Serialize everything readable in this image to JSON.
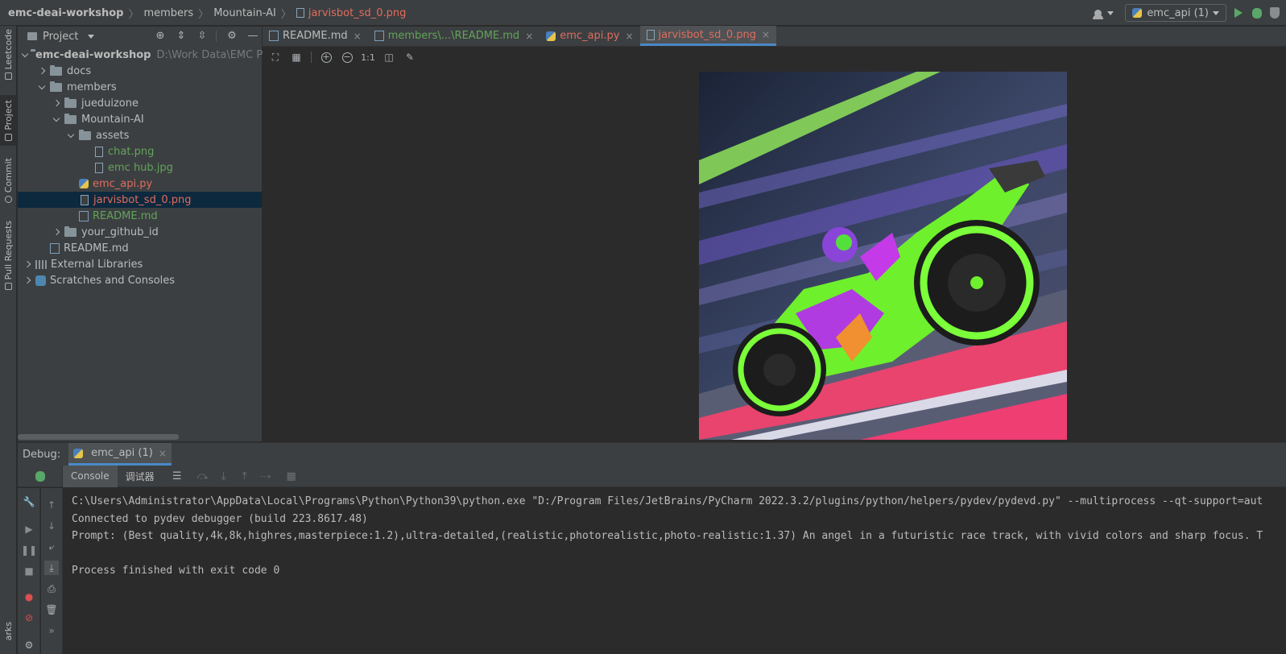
{
  "breadcrumbs": [
    "emc-deai-workshop",
    "members",
    "Mountain-AI",
    "jarvisbot_sd_0.png"
  ],
  "run_config": {
    "label": "emc_api (1)"
  },
  "left_strip": [
    "Leetcode",
    "Project",
    "Commit",
    "Pull Requests",
    "arks"
  ],
  "project_panel": {
    "title": "Project",
    "tree": [
      {
        "label": "emc-deai-workshop",
        "path": "D:\\Work Data\\EMC Pro",
        "depth": 0,
        "expand": "down",
        "icon": "folder-icon",
        "style": "bold"
      },
      {
        "label": "docs",
        "depth": 1,
        "expand": "right",
        "icon": "folder-icon",
        "style": ""
      },
      {
        "label": "members",
        "depth": 1,
        "expand": "down",
        "icon": "folder-icon",
        "style": ""
      },
      {
        "label": "jueduizone",
        "depth": 2,
        "expand": "right",
        "icon": "folder-icon",
        "style": ""
      },
      {
        "label": "Mountain-AI",
        "depth": 2,
        "expand": "down",
        "icon": "folder-icon",
        "style": ""
      },
      {
        "label": "assets",
        "depth": 3,
        "expand": "down",
        "icon": "folder-icon",
        "style": ""
      },
      {
        "label": "chat.png",
        "depth": 4,
        "expand": "none",
        "icon": "image-file-icon",
        "style": "green"
      },
      {
        "label": "emc hub.jpg",
        "depth": 4,
        "expand": "none",
        "icon": "image-file-icon",
        "style": "green"
      },
      {
        "label": "emc_api.py",
        "depth": 3,
        "expand": "none",
        "icon": "python-file-icon",
        "style": "red"
      },
      {
        "label": "jarvisbot_sd_0.png",
        "depth": 3,
        "expand": "none",
        "icon": "image-file-icon",
        "style": "red",
        "selected": true
      },
      {
        "label": "README.md",
        "depth": 3,
        "expand": "none",
        "icon": "markdown-file-icon",
        "style": "green"
      },
      {
        "label": "your_github_id",
        "depth": 2,
        "expand": "right",
        "icon": "folder-icon",
        "style": ""
      },
      {
        "label": "README.md",
        "depth": 1,
        "expand": "none",
        "icon": "markdown-file-icon",
        "style": ""
      },
      {
        "label": "External Libraries",
        "depth": 0,
        "expand": "right",
        "icon": "library-icon",
        "style": ""
      },
      {
        "label": "Scratches and Consoles",
        "depth": 0,
        "expand": "right",
        "icon": "scratches-icon",
        "style": ""
      }
    ]
  },
  "editor_tabs": [
    {
      "label": "README.md",
      "icon": "markdown-file-icon",
      "style": "",
      "active": false
    },
    {
      "label": "members\\...\\README.md",
      "icon": "markdown-file-icon",
      "style": "green",
      "active": false
    },
    {
      "label": "emc_api.py",
      "icon": "python-file-icon",
      "style": "red",
      "active": false
    },
    {
      "label": "jarvisbot_sd_0.png",
      "icon": "image-file-icon",
      "style": "red",
      "active": true
    }
  ],
  "image_toolbar": {
    "actual_size_label": "1:1"
  },
  "debug": {
    "title": "Debug:",
    "session_label": "emc_api (1)",
    "tabs": [
      "Console",
      "调试器"
    ],
    "console_lines": [
      "C:\\Users\\Administrator\\AppData\\Local\\Programs\\Python\\Python39\\python.exe \"D:/Program Files/JetBrains/PyCharm 2022.3.2/plugins/python/helpers/pydev/pydevd.py\" --multiprocess --qt-support=aut",
      "Connected to pydev debugger (build 223.8617.48)",
      "Prompt: (Best quality,4k,8k,highres,masterpiece:1.2),ultra-detailed,(realistic,photorealistic,photo-realistic:1.37) An angel in a futuristic race track, with vivid colors and sharp focus. T",
      "",
      "Process finished with exit code 0"
    ]
  },
  "colors": {
    "accent": "#4a88c7",
    "modified_file": "#e06c5f",
    "added_file": "#62a45a",
    "run_green": "#59a869"
  }
}
